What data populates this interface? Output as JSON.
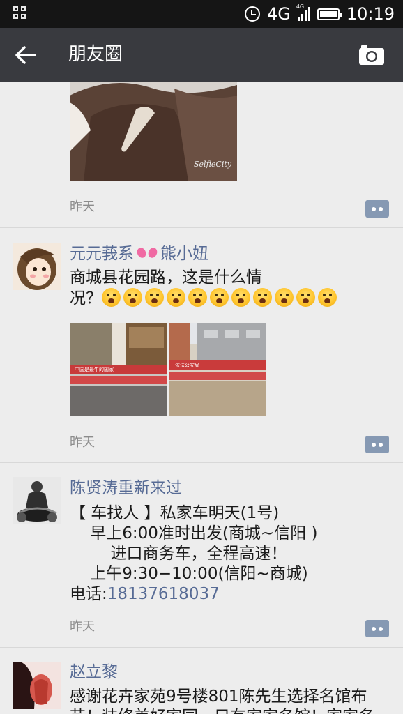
{
  "status_bar": {
    "network": "4G",
    "signal_label": "4G",
    "time": "10:19",
    "icons": [
      "grid-icon",
      "alarm-icon",
      "signal-icon",
      "battery-icon"
    ]
  },
  "header": {
    "title": "朋友圈",
    "back_icon": "arrow-left-icon",
    "camera_icon": "camera-icon"
  },
  "posts": [
    {
      "time": "昨天",
      "image_watermark": "SelfieCity"
    },
    {
      "author": "元元莪系",
      "author_suffix": "熊小妞",
      "text_lines": [
        "商城县花园路，这是什么情",
        "况？"
      ],
      "emoji_count": 11,
      "image_banner_left": "中国是最牛的国家",
      "image_banner_right": "依法公安局",
      "time": "昨天"
    },
    {
      "author": "陈贤涛重新来过",
      "text_lines": [
        "【 车找人 】私家车明天(1号)",
        "    早上6:00准时出发(商城~信阳 )",
        "        进口商务车，全程高速！",
        "    上午9:30−10:00(信阳~商城)"
      ],
      "phone_label": "电话:",
      "phone": "18137618037",
      "time": "昨天"
    },
    {
      "author": "赵立黎",
      "text_lines": [
        "感谢花卉家苑9号楼801陈先生选择名馆布",
        "艺！装修美好家园，只有家家名馆！家家名"
      ]
    }
  ],
  "colors": {
    "title_bar": "#393a3f",
    "status_bar": "#151515",
    "link": "#576b95",
    "background": "#ededed",
    "comment_button": "#8699b3"
  }
}
